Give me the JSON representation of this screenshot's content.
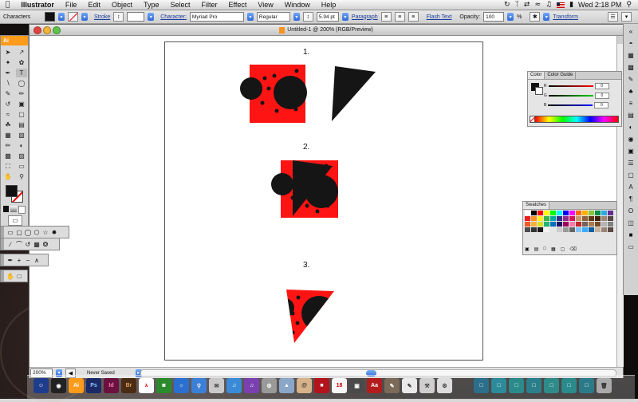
{
  "menubar": {
    "app": "Illustrator",
    "items": [
      "File",
      "Edit",
      "Object",
      "Type",
      "Select",
      "Filter",
      "Effect",
      "View",
      "Window",
      "Help"
    ],
    "clock": "Wed 2:18 PM"
  },
  "control": {
    "mode": "Characters",
    "stroke_label": "Stroke",
    "character_label": "Character:",
    "font": "Myriad Pro",
    "style": "Regular",
    "size": "5.94 pt",
    "paragraph_label": "Paragraph",
    "flash_label": "Flash Text",
    "opacity_label": "Opacity:",
    "opacity": "100",
    "opacity_unit": "%",
    "transform_label": "Transform"
  },
  "document": {
    "title": "Untitled-1 @ 200% (RGB/Preview)",
    "zoom": "200%",
    "status": "Never Saved"
  },
  "artboard": {
    "labels": [
      "1.",
      "2.",
      "3."
    ],
    "fill_colors": {
      "red": "#ff1414",
      "black": "#151515"
    }
  },
  "tools_panel": {
    "header": "Ai"
  },
  "color_panel": {
    "tabs": [
      "Color",
      "Color Guide"
    ],
    "channels": [
      {
        "name": "R",
        "value": "0"
      },
      {
        "name": "G",
        "value": "0"
      },
      {
        "name": "B",
        "value": "0"
      }
    ]
  },
  "swatches_panel": {
    "title": "Swatches"
  },
  "dock": {
    "icons": [
      "finder",
      "dashboard",
      "illustrator",
      "photoshop",
      "indesign",
      "bridge",
      "acrobat",
      "safari",
      "itunes",
      "mail",
      "ical",
      "address-book",
      "preview",
      "firefox",
      "terminal",
      "trash"
    ]
  }
}
